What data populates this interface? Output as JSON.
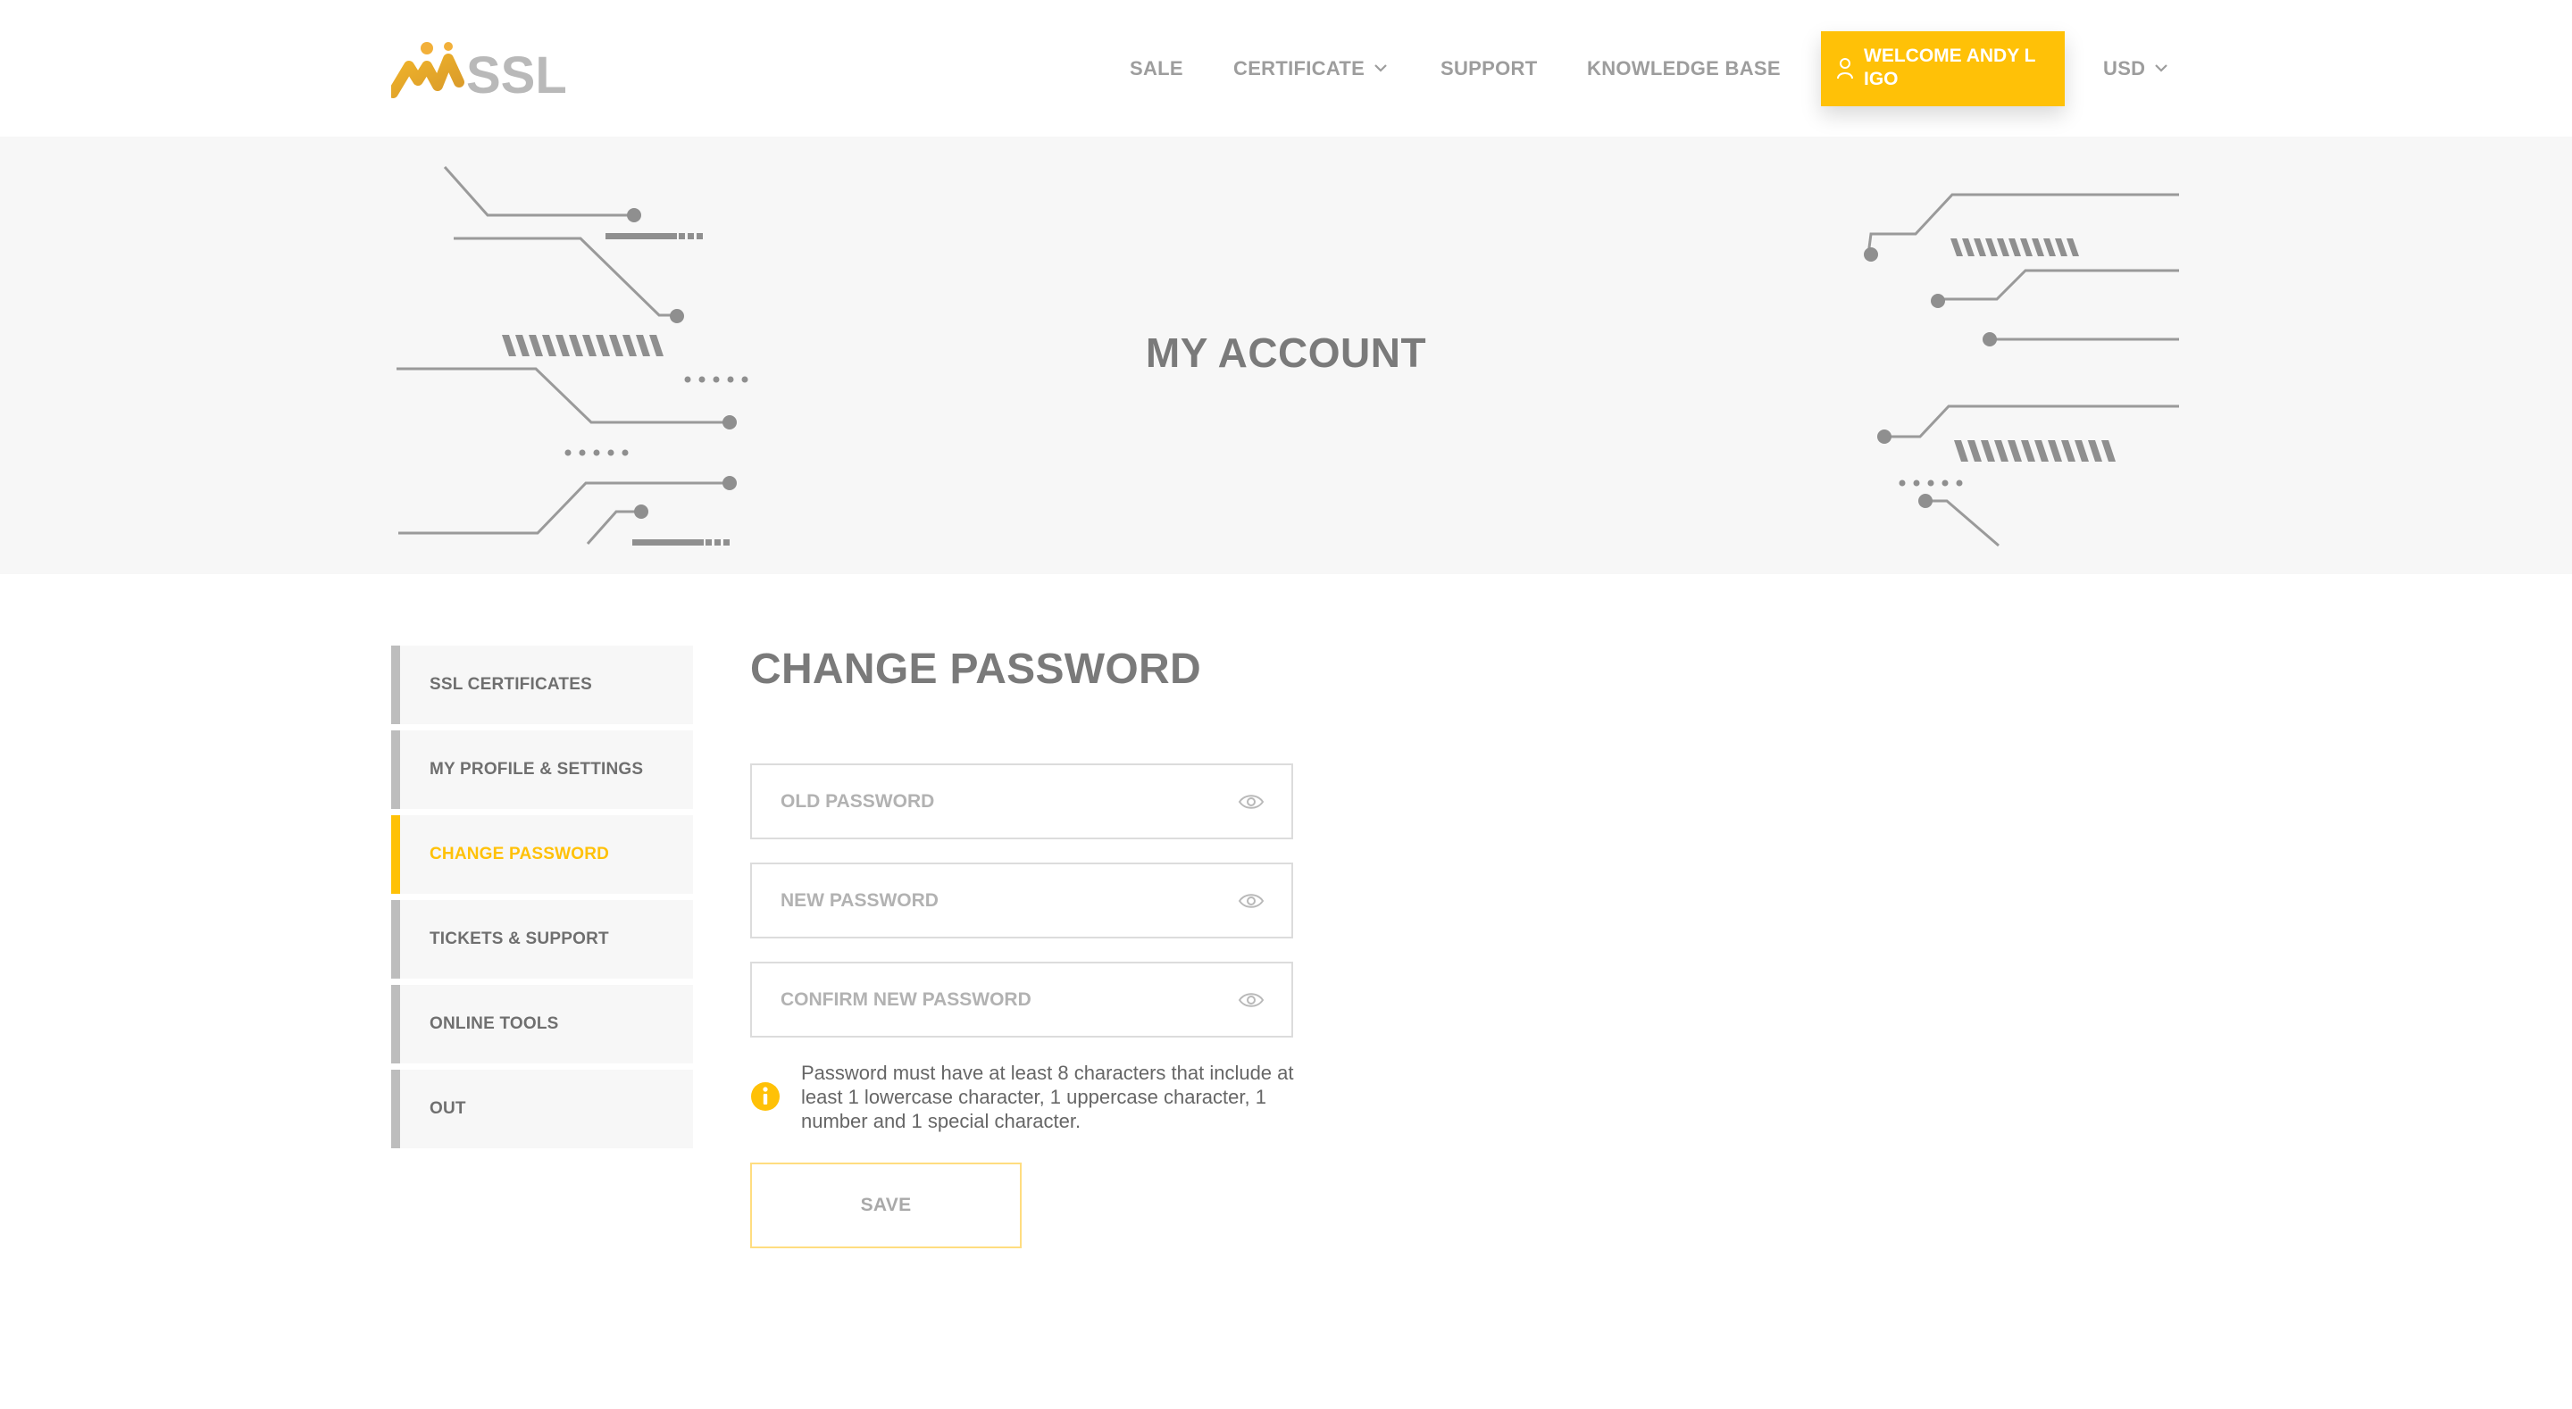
{
  "header": {
    "logo_text": "SSL",
    "nav": [
      {
        "label": "SALE"
      },
      {
        "label": "CERTIFICATE"
      },
      {
        "label": "SUPPORT"
      },
      {
        "label": "KNOWLEDGE BASE"
      }
    ],
    "welcome_label": "WELCOME ANDY L IGO",
    "currency": "USD"
  },
  "hero": {
    "title": "MY ACCOUNT"
  },
  "sidebar": {
    "items": [
      {
        "label": "SSL CERTIFICATES"
      },
      {
        "label": "MY PROFILE & SETTINGS"
      },
      {
        "label": "CHANGE PASSWORD",
        "active": true
      },
      {
        "label": "TICKETS & SUPPORT"
      },
      {
        "label": "ONLINE TOOLS"
      },
      {
        "label": "OUT"
      }
    ]
  },
  "content": {
    "title": "CHANGE PASSWORD",
    "fields": [
      {
        "placeholder": "OLD PASSWORD",
        "value": ""
      },
      {
        "placeholder": "NEW PASSWORD",
        "value": ""
      },
      {
        "placeholder": "CONFIRM NEW PASSWORD",
        "value": ""
      }
    ],
    "hint": "Password must have at least 8 characters that include at least 1 lowercase character, 1 uppercase character, 1 number and 1 special character.",
    "save_label": "SAVE"
  },
  "colors": {
    "accent": "#ffc107",
    "hero_bg": "#f7f7f7",
    "text_gray": "#7a7a7a",
    "nav_gray": "#9d9d9d"
  },
  "icons": [
    "logo-mark",
    "user-icon",
    "chevron-down-icon",
    "eye-icon",
    "info-icon"
  ]
}
